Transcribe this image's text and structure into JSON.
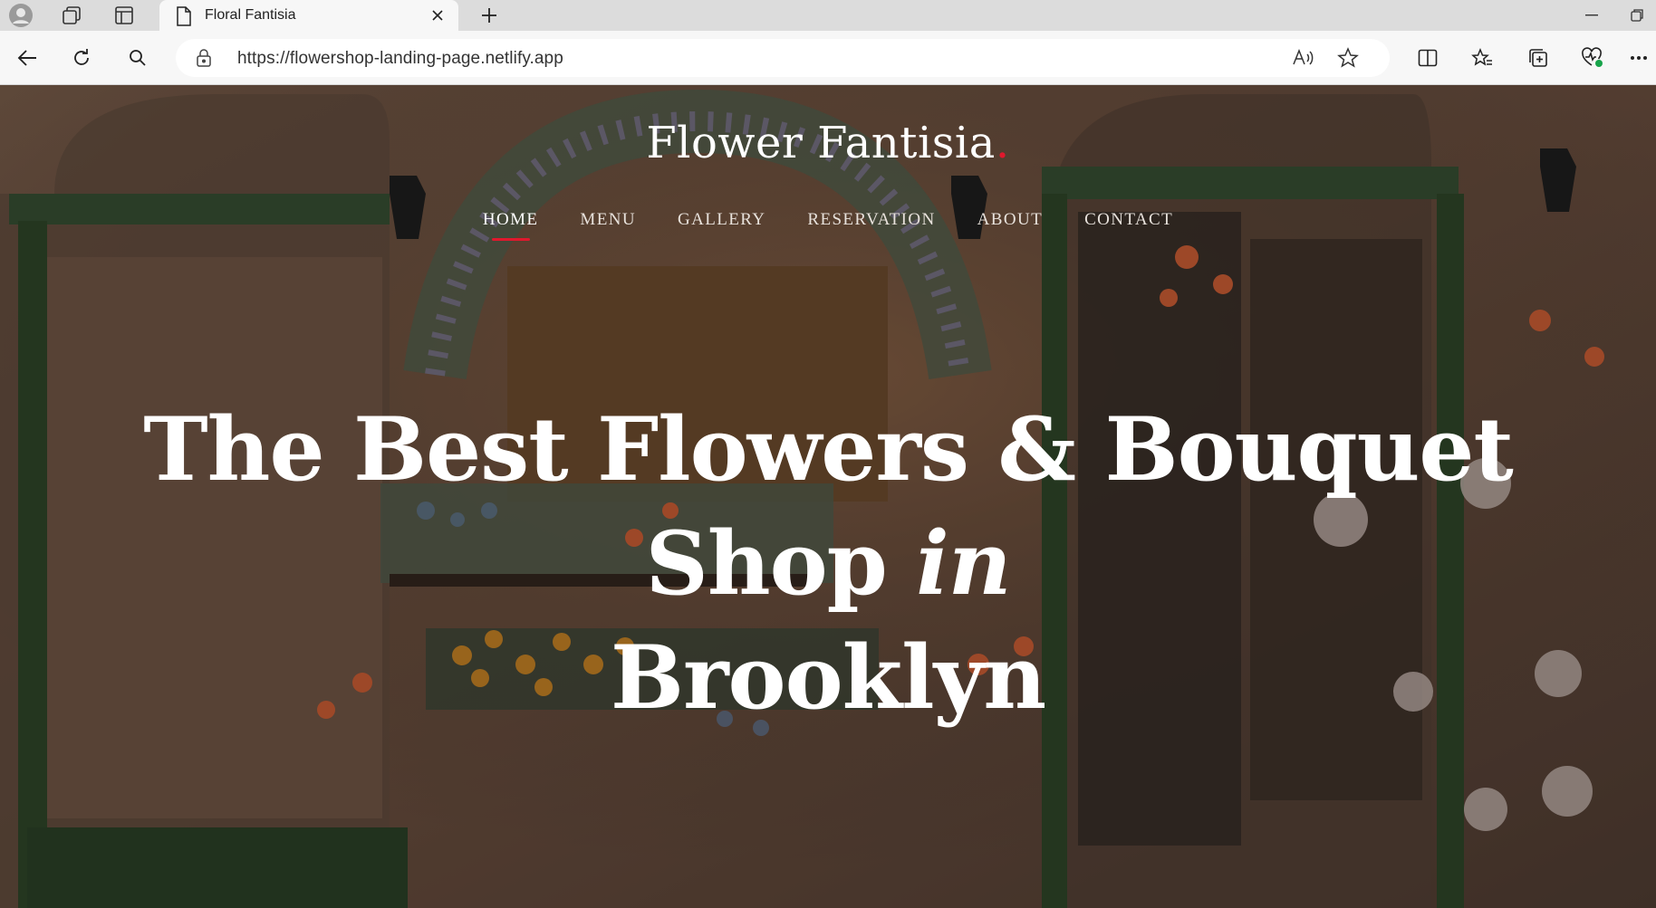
{
  "browser": {
    "tab": {
      "title": "Floral Fantisia"
    },
    "address": {
      "url": "https://flowershop-landing-page.netlify.app"
    }
  },
  "hero": {
    "brand": "Flower Fantisia",
    "brand_dot": ".",
    "nav": [
      {
        "label": "HOME",
        "active": true
      },
      {
        "label": "MENU",
        "active": false
      },
      {
        "label": "GALLERY",
        "active": false
      },
      {
        "label": "RESERVATION",
        "active": false
      },
      {
        "label": "ABOUT",
        "active": false
      },
      {
        "label": "CONTACT",
        "active": false
      }
    ],
    "headline_main": "The Best Flowers & Bouquet Shop",
    "headline_em": "in",
    "headline_end": "Brooklyn"
  },
  "colors": {
    "accent": "#e0182d",
    "overlay": "#000000"
  }
}
